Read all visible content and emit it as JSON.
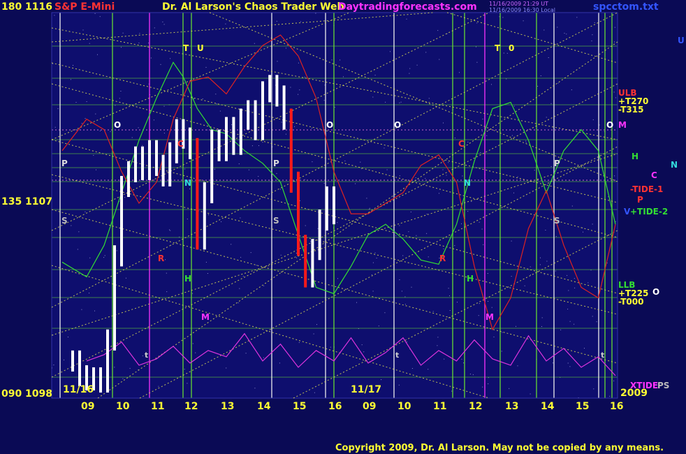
{
  "header": {
    "scale_top": "180",
    "price_top": "1116",
    "symbol": "S&P E-Mini",
    "title": "Dr. Al Larson's Chaos Trader Web",
    "site": "Daytradingforecasts.com",
    "timestamp_1": "11/16/2009 21:29 UT",
    "timestamp_2": "11/16/2009 16:30 Local",
    "file": "spcctom.txt"
  },
  "left_axis": [
    {
      "scale": "135",
      "price": "1107"
    },
    {
      "scale": "090",
      "price": "1098"
    }
  ],
  "date_labels": {
    "d1": "11/16",
    "d2": "11/17",
    "year": "2009"
  },
  "hour_ticks": [
    "09",
    "10",
    "11",
    "12",
    "13",
    "14",
    "15",
    "16",
    "09",
    "10",
    "11",
    "12",
    "13",
    "14",
    "15",
    "16"
  ],
  "right_labels": {
    "ulb": "ULB",
    "t270": "+T270",
    "t315": "-T315",
    "m": "M",
    "h": "H",
    "n": "N",
    "c": "C",
    "tide1": "-TIDE-1",
    "p": "P",
    "tide2": "+TIDE-2",
    "v": "V",
    "llb": "LLB",
    "t225": "+T225",
    "t000": "-T000",
    "o": "O",
    "u": "U",
    "xtide": "XTIDE",
    "ps": "PS"
  },
  "markers": {
    "T": "T",
    "U": "U",
    "zero": "0",
    "O": "O",
    "P": "P",
    "S": "S",
    "C": "C",
    "N": "N",
    "R": "R",
    "H": "H",
    "M": "M",
    "t": "t"
  },
  "footer": {
    "copyright": "Copyright 2009, Dr. Al Larson. May not be copied by any means."
  },
  "colors": {
    "background": "#0a0a55",
    "plot_background": "#0e0e6e",
    "price_bar": "#ffffff",
    "down_bar": "#ff1a1a",
    "green_line": "#33dd33",
    "red_line": "#dd2222",
    "magenta_line": "#dd33dd",
    "blue_line": "#2244ff",
    "diagonal": "#dddd55",
    "grid_green": "#66dd33",
    "white_vline": "#f0f0f0",
    "yellow_text": "#ffff33"
  },
  "chart_data": {
    "type": "line",
    "title": "S&P E-Mini",
    "x_label_unit": "hour",
    "ylim": [
      1098,
      1116
    ],
    "yticks": [
      1098,
      1107,
      1116
    ],
    "series": [
      {
        "name": "price",
        "kind": "bars",
        "hours": [
          8.6,
          8.8,
          9.0,
          9.2,
          9.4,
          9.6,
          9.8,
          10.0,
          10.2,
          10.4,
          10.6,
          10.8,
          11.0,
          11.2,
          11.4,
          11.6,
          11.8,
          12.0,
          12.2,
          12.4,
          12.6,
          12.8,
          13.0,
          13.2,
          13.4,
          13.6,
          13.8,
          14.0,
          14.2,
          14.4,
          14.6,
          14.8,
          15.0,
          15.2,
          15.4,
          15.6,
          15.8,
          16.0
        ],
        "close": [
          1099.5,
          1098.8,
          1098.6,
          1098.7,
          1098.5,
          1100.5,
          1104.5,
          1107.8,
          1108.5,
          1109.2,
          1108.6,
          1109.5,
          1108.8,
          1108.3,
          1109.4,
          1110.5,
          1110.1,
          1109.6,
          1105.3,
          1107.5,
          1110.0,
          1109.5,
          1110.6,
          1109.8,
          1111.0,
          1111.4,
          1110.5,
          1112.3,
          1112.6,
          1112.1,
          1111.0,
          1108.0,
          1105.0,
          1103.5,
          1104.8,
          1106.2,
          1107.3,
          1106.5
        ]
      },
      {
        "name": "green",
        "hours": [
          8.3,
          9.0,
          9.5,
          10.0,
          10.5,
          11.0,
          11.5,
          11.8,
          12.2,
          12.6,
          13.0,
          13.5,
          14.0,
          14.5,
          15.0,
          15.5,
          16.0,
          16.5,
          17.0,
          17.5,
          18.0,
          18.5,
          19.0,
          19.5,
          20.0,
          20.5,
          21.0,
          21.5,
          22.0,
          22.5,
          23.0,
          23.5,
          24.0
        ],
        "values": [
          1104.2,
          1103.5,
          1105.0,
          1107.5,
          1110.0,
          1112.0,
          1113.7,
          1113.0,
          1111.5,
          1110.5,
          1110.3,
          1109.5,
          1108.9,
          1108.0,
          1105.5,
          1103.0,
          1102.7,
          1104.0,
          1105.5,
          1106.0,
          1105.3,
          1104.3,
          1104.1,
          1106.0,
          1109.0,
          1111.5,
          1111.8,
          1110.0,
          1107.5,
          1109.5,
          1110.5,
          1109.5,
          1106.0
        ]
      },
      {
        "name": "red",
        "hours": [
          8.3,
          9.0,
          9.5,
          10.0,
          10.5,
          11.0,
          11.5,
          12.0,
          12.5,
          13.0,
          13.5,
          14.0,
          14.5,
          15.0,
          15.5,
          16.0,
          16.5,
          17.0,
          17.5,
          18.0,
          18.5,
          19.0,
          19.5,
          20.0,
          20.5,
          21.0,
          21.5,
          22.0,
          22.5,
          23.0,
          23.5,
          24.0
        ],
        "values": [
          1109.5,
          1111.0,
          1110.5,
          1108.5,
          1107.0,
          1108.0,
          1111.0,
          1112.8,
          1113.0,
          1112.2,
          1113.5,
          1114.5,
          1115.0,
          1114.0,
          1112.0,
          1108.5,
          1106.5,
          1106.5,
          1107.0,
          1107.5,
          1108.8,
          1109.3,
          1108.0,
          1104.0,
          1101.0,
          1102.5,
          1105.8,
          1107.6,
          1105.0,
          1103.0,
          1102.5,
          1106.0
        ]
      },
      {
        "name": "magenta_tide",
        "hours": [
          9.0,
          9.5,
          10.0,
          10.5,
          11.0,
          11.5,
          12.0,
          12.5,
          13.0,
          13.5,
          14.0,
          14.5,
          15.0,
          15.5,
          16.0,
          16.5,
          17.0,
          17.5,
          18.0,
          18.5,
          19.0,
          19.5,
          20.0,
          20.5,
          21.0,
          21.5,
          22.0,
          22.5,
          23.0,
          23.5,
          24.0
        ],
        "values": [
          1099.5,
          1099.8,
          1100.4,
          1099.3,
          1099.6,
          1100.2,
          1099.4,
          1100.0,
          1099.7,
          1100.8,
          1099.5,
          1100.3,
          1099.2,
          1100.0,
          1099.5,
          1100.6,
          1099.4,
          1099.9,
          1100.6,
          1099.3,
          1100.0,
          1099.5,
          1100.5,
          1099.6,
          1099.3,
          1100.7,
          1099.5,
          1100.1,
          1099.2,
          1099.7,
          1098.8
        ]
      }
    ]
  }
}
